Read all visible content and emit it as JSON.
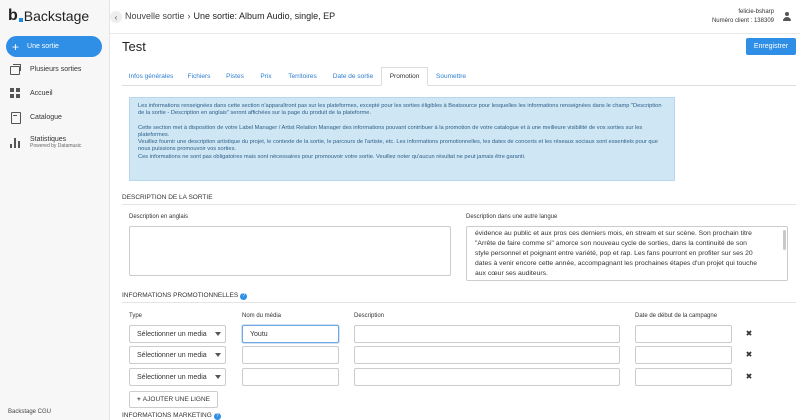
{
  "brand": {
    "letter": "b",
    "name": "Backstage"
  },
  "sidebar": {
    "primary": {
      "label": "Une sortie"
    },
    "items": [
      {
        "label": "Plusieurs sorties",
        "icon": "stack-icon"
      },
      {
        "label": "Accueil",
        "icon": "grid-icon"
      },
      {
        "label": "Catalogue",
        "icon": "book-icon"
      },
      {
        "label": "Statistiques",
        "sub": "Powered by Datamusic",
        "icon": "bars-icon"
      }
    ],
    "footer": "Backstage CGU"
  },
  "header": {
    "breadcrumb": {
      "parent": "Nouvelle sortie",
      "separator": "›",
      "current": "Une sortie: Album Audio, single, EP"
    },
    "user": {
      "name": "felicie-bsharp",
      "client": "Numéro client : 138309"
    }
  },
  "page": {
    "title": "Test",
    "save_label": "Enregistrer"
  },
  "tabs": [
    {
      "label": "Infos générales",
      "active": false
    },
    {
      "label": "Fichiers",
      "active": false
    },
    {
      "label": "Pistes",
      "active": false
    },
    {
      "label": "Prix",
      "active": false
    },
    {
      "label": "Territoires",
      "active": false
    },
    {
      "label": "Date de sortie",
      "active": false
    },
    {
      "label": "Promotion",
      "active": true
    },
    {
      "label": "Soumettre",
      "active": false
    }
  ],
  "info": {
    "p1": "Les informations renseignées dans cette section n'apparaîtront pas sur les plateformes, excepté pour les sorties éligibles à Beatsource pour lesquelles les informations renseignées dans le champ \"Description de la sortie - Description en anglais\" seront affichées sur la page du produit de la plateforme.",
    "p2": "Cette section met à disposition de votre Label Manager / Artist Relation Manager des informations pouvant contribuer à la promotion de votre catalogue et à une meilleure visibilité de vos sorties sur les plateformes.",
    "p3": "Veuillez fournir une description artistique du projet, le contexte de la sortie, le parcours de l'artiste, etc. Les informations promotionnelles, les dates de concerts et les réseaux sociaux sont essentiels pour que nous puissions promouvoir vos sorties.",
    "p4": "Ces informations ne sont pas obligatoires mais sont nécessaires pour promouvoir votre sortie. Veuillez noter qu'aucun résultat ne peut jamais être garanti."
  },
  "description": {
    "section_title": "DESCRIPTION DE LA SORTIE",
    "english_label": "Description en anglais",
    "english_value": "",
    "other_label": "Description dans une autre langue",
    "other_lines": [
      "évidence au public et aux pros ces derniers mois, en stream et sur scène. Son prochain titre",
      "\"Arrête de faire comme si\" amorce son nouveau cycle de sorties, dans la continuité de son",
      "style personnel et poignant entre variété, pop et rap. Les fans pourront en profiter sur ses 20",
      "dates à venir encore cette année, accompagnant les prochaines étapes d'un projet qui touche",
      "aux cœur ses auditeurs."
    ]
  },
  "promo": {
    "section_title": "INFORMATIONS PROMOTIONNELLES",
    "help": "?",
    "columns": {
      "type": "Type",
      "media": "Nom du média",
      "description": "Description",
      "date": "Date de début de la campagne"
    },
    "select_placeholder": "Sélectionner un media",
    "rows": [
      {
        "media": "Youtu",
        "description": "",
        "date": ""
      },
      {
        "media": "",
        "description": "",
        "date": ""
      },
      {
        "media": "",
        "description": "",
        "date": ""
      }
    ],
    "remove_symbol": "✖",
    "add_label": "AJOUTER UNE LIGNE",
    "add_plus": "+"
  },
  "marketing": {
    "section_title": "INFORMATIONS MARKETING",
    "help": "?"
  }
}
